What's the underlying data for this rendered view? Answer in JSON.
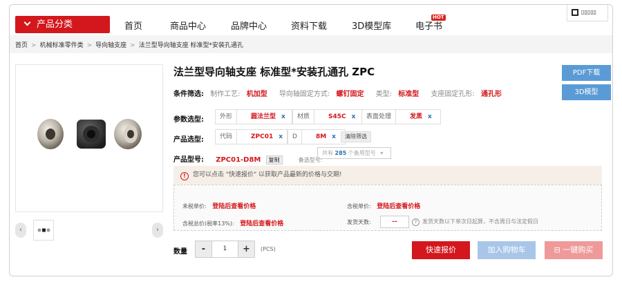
{
  "nav": {
    "category_button": "产品分类",
    "items": [
      "首页",
      "商品中心",
      "品牌中心",
      "资料下载",
      "3D模型库",
      "电子书"
    ],
    "hot_badge": "HOT"
  },
  "breadcrumb": [
    "首页",
    "机械标准零件类",
    "导向轴支座",
    "法兰型导向轴支座 标准型*安装孔通孔"
  ],
  "product": {
    "title": "法兰型导向轴支座 标准型*安装孔通孔  ZPC",
    "pdf_button": "PDF下载",
    "model_button": "3D模型"
  },
  "conditions": {
    "label": "条件筛选:",
    "items": [
      {
        "key": "制作工艺:",
        "value": "机加型"
      },
      {
        "key": "导向轴固定方式:",
        "value": "螺钉固定"
      },
      {
        "key": "类型:",
        "value": "标准型"
      },
      {
        "key": "支座固定孔形:",
        "value": "通孔形"
      }
    ]
  },
  "params": {
    "label": "参数选型:",
    "chips": [
      {
        "key": "外形",
        "value": "圆法兰型",
        "x": "x"
      },
      {
        "key": "材质",
        "value": "S45C",
        "x": "x"
      },
      {
        "key": "表面处理",
        "value": "发黑",
        "x": "x"
      }
    ]
  },
  "product_select": {
    "label": "产品选型:",
    "chips": [
      {
        "key": "代码",
        "value": "ZPC01",
        "x": "x"
      },
      {
        "key": "D",
        "value": "8M",
        "x": "x"
      }
    ],
    "clear_button": "清除筛选"
  },
  "model": {
    "label": "产品型号:",
    "value": "ZPC01-D8M",
    "copy_button": "复制",
    "alt_label": "备选型号:",
    "dropdown_prefix": "共有",
    "dropdown_count": "285",
    "dropdown_suffix": "个备用型号"
  },
  "notice": {
    "text": "您可以点击 \"快速报价\" 以获取产品最新的价格与交期!"
  },
  "pricing": {
    "untaxed_label": "未税单价:",
    "untaxed_value": "登陆后查看价格",
    "taxed_label": "含税单价:",
    "taxed_value": "登陆后查看价格",
    "total_label": "含税总价(税率13%):",
    "total_value": "登陆后查看价格",
    "ship_label": "发货天数:",
    "ship_value": "--",
    "ship_note": "发货天数以下单次日起算，不含周日与法定假日"
  },
  "quantity": {
    "label": "数量",
    "minus": "-",
    "value": "1",
    "plus": "+",
    "unit": "(PCS)"
  },
  "actions": {
    "quote": "快速报价",
    "cart": "加入购物车",
    "buy": "一键购买"
  },
  "colors": {
    "brand_red": "#d3171d",
    "blue_button": "#5b9bd5",
    "cart_disabled": "#a9c6e8",
    "buy_disabled": "#ef9a9a"
  }
}
